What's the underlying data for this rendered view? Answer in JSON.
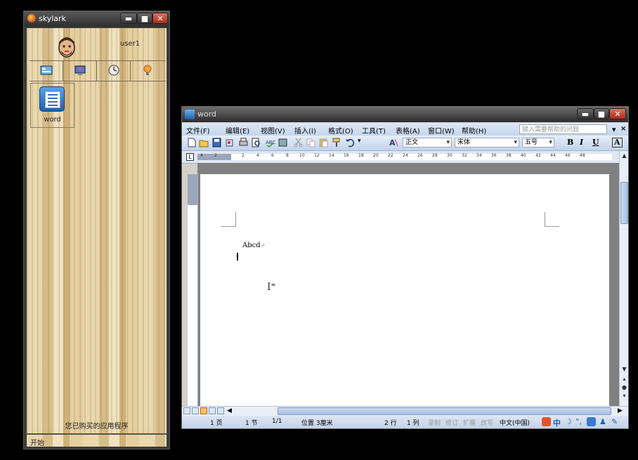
{
  "skylark": {
    "title": "skylark",
    "window_controls": {
      "min": "▬",
      "max": "■",
      "close": "✕"
    },
    "user": {
      "name": "user1"
    },
    "tabs": [
      "apps-tab",
      "desktop-tab",
      "clock-tab",
      "settings-tab"
    ],
    "apps": [
      {
        "label": "word",
        "icon": "word-icon"
      }
    ],
    "purchased_label": "您已购买的应用程序",
    "start_label": "开始"
  },
  "word": {
    "title": "word",
    "window_controls": {
      "min": "▬",
      "max": "■",
      "close": "✕"
    },
    "menu": [
      "文件(F)",
      "编辑(E)",
      "视图(V)",
      "插入(I)",
      "格式(O)",
      "工具(T)",
      "表格(A)",
      "窗口(W)",
      "帮助(H)"
    ],
    "help_placeholder": "键入需要帮助的问题",
    "menu_close": "×",
    "style_combo": "正文",
    "font_combo": "宋体",
    "size_combo": "五号",
    "format_buttons": {
      "bold": "B",
      "italic": "I",
      "underline": "U",
      "charborder": "A"
    },
    "ruler_ticks": [
      "4",
      "2",
      "2",
      "4",
      "6",
      "8",
      "10",
      "12",
      "14",
      "16",
      "18",
      "20",
      "22",
      "24",
      "26",
      "28",
      "30",
      "32",
      "34",
      "36",
      "38",
      "40",
      "42",
      "44",
      "46",
      "48"
    ],
    "document": {
      "line1": "Abcd",
      "paragraph_mark": "↵"
    },
    "status": {
      "page": "1 页",
      "section": "1 节",
      "pages": "1/1",
      "position": "位置 3厘米",
      "line": "2 行",
      "col": "1 列",
      "rec": "录制",
      "trk": "修订",
      "ext": "扩展",
      "ovr": "改写",
      "lang": "中文(中国)"
    },
    "colors": {
      "title_bar": "#2c2c2c",
      "accent": "#1e60b0",
      "ruler": "#dfe7f2"
    }
  }
}
